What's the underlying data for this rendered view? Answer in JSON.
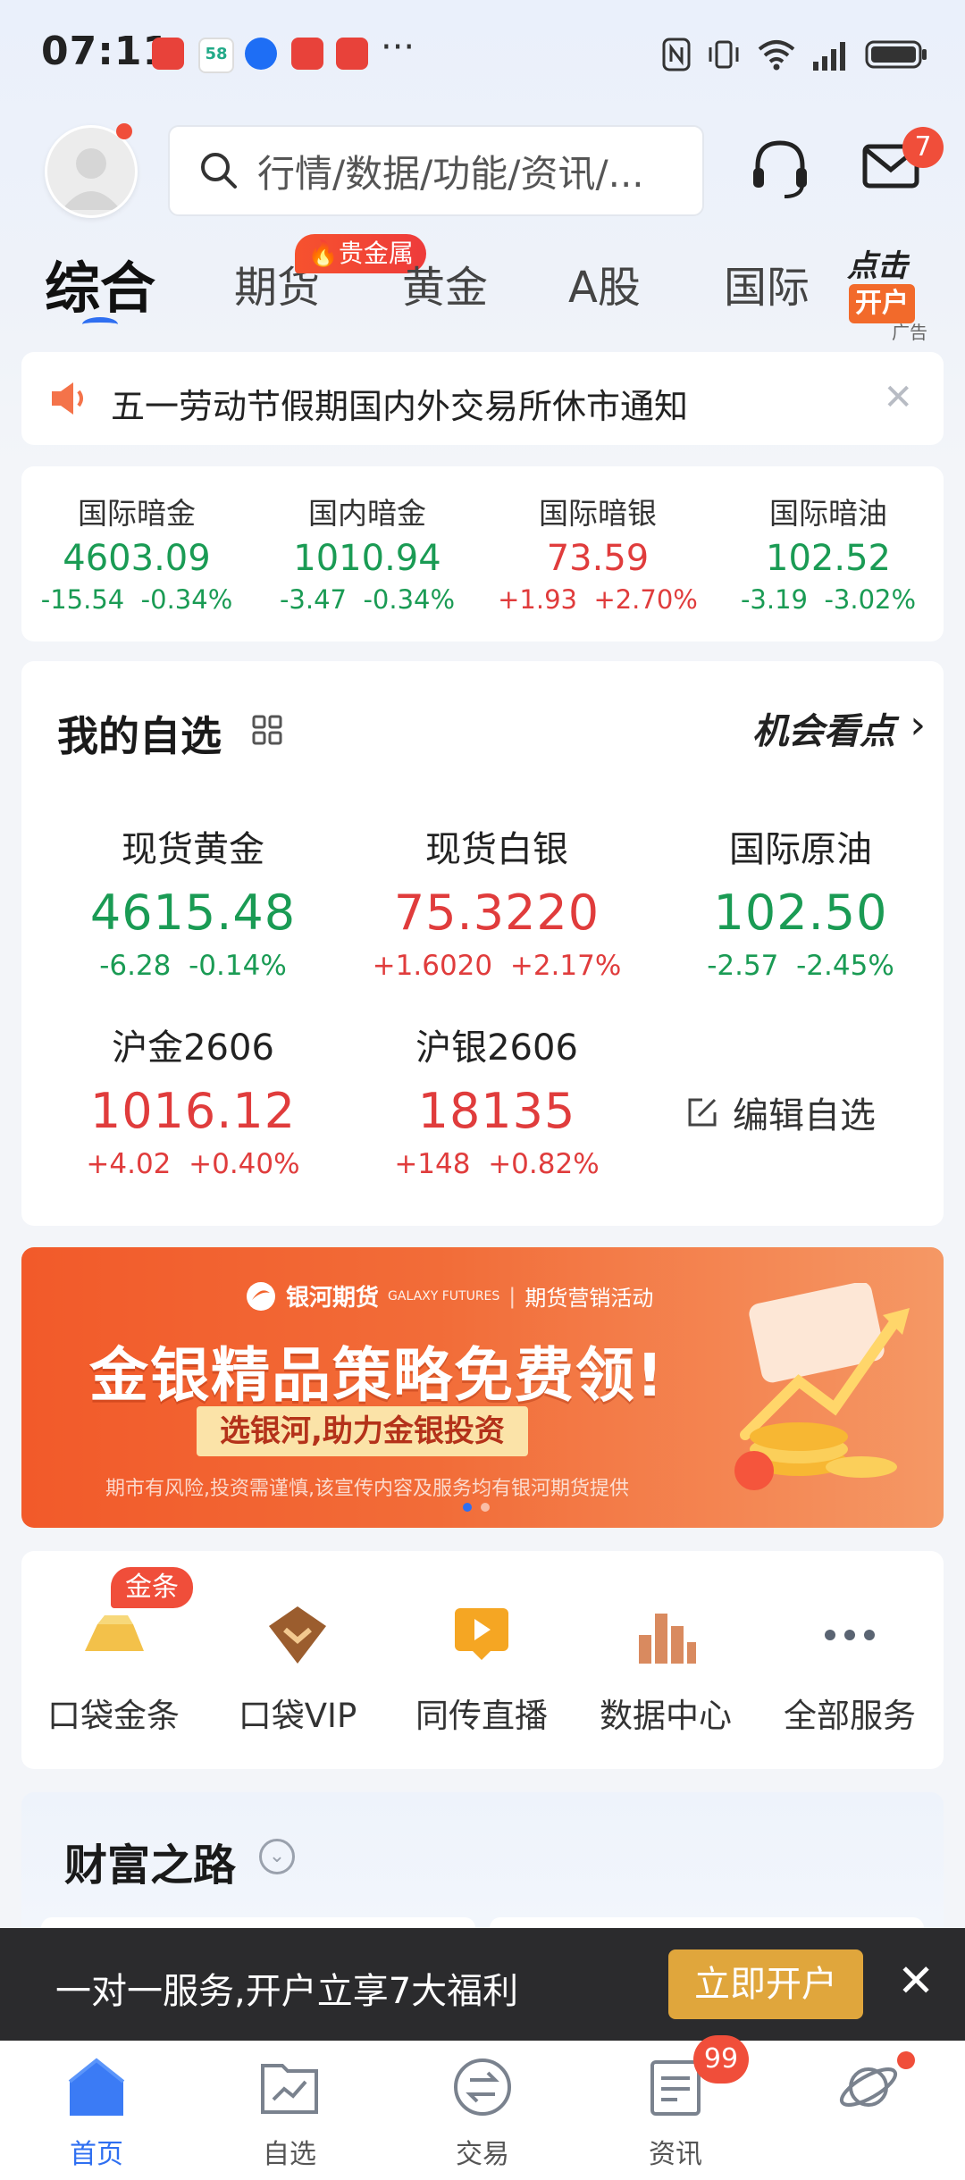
{
  "status_bar": {
    "time": "07:11",
    "more": "···"
  },
  "header": {
    "search_placeholder": "行情/数据/功能/资讯/...",
    "message_badge": "7"
  },
  "tabs": [
    {
      "label": "综合",
      "active": true
    },
    {
      "label": "期货",
      "active": false,
      "badge": "贵金属"
    },
    {
      "label": "黄金",
      "active": false
    },
    {
      "label": "A股",
      "active": false
    },
    {
      "label": "国际",
      "active": false
    }
  ],
  "ad": {
    "line1": "点击",
    "line2": "开户",
    "tag": "广告"
  },
  "notice": {
    "text": "五一劳动节假期国内外交易所休市通知"
  },
  "indices": [
    {
      "name": "国际暗金",
      "value": "4603.09",
      "change": "-15.54",
      "pct": "-0.34%",
      "dir": "down"
    },
    {
      "name": "国内暗金",
      "value": "1010.94",
      "change": "-3.47",
      "pct": "-0.34%",
      "dir": "down"
    },
    {
      "name": "国际暗银",
      "value": "73.59",
      "change": "+1.93",
      "pct": "+2.70%",
      "dir": "up"
    },
    {
      "name": "国际暗油",
      "value": "102.52",
      "change": "-3.19",
      "pct": "-3.02%",
      "dir": "down"
    }
  ],
  "watchlist": {
    "title": "我的自选",
    "opportunity": "机会看点",
    "edit_label": "编辑自选",
    "items": [
      {
        "name": "现货黄金",
        "value": "4615.48",
        "change": "-6.28",
        "pct": "-0.14%",
        "dir": "down"
      },
      {
        "name": "现货白银",
        "value": "75.3220",
        "change": "+1.6020",
        "pct": "+2.17%",
        "dir": "up"
      },
      {
        "name": "国际原油",
        "value": "102.50",
        "change": "-2.57",
        "pct": "-2.45%",
        "dir": "down"
      },
      {
        "name": "沪金2606",
        "value": "1016.12",
        "change": "+4.02",
        "pct": "+0.40%",
        "dir": "up"
      },
      {
        "name": "沪银2606",
        "value": "18135",
        "change": "+148",
        "pct": "+0.82%",
        "dir": "up"
      }
    ]
  },
  "banner": {
    "logo": "银河期货",
    "logo_sub": "GALAXY FUTURES",
    "activity": "期货营销活动",
    "title": "金银精品策略免费领!",
    "subtitle": "选银河,助力金银投资",
    "risk": "期市有风险,投资需谨慎,该宣传内容及服务均有银河期货提供"
  },
  "services": [
    {
      "label": "口袋金条",
      "badge": "金条",
      "icon": "gold-bar-icon"
    },
    {
      "label": "口袋VIP",
      "icon": "vip-diamond-icon"
    },
    {
      "label": "同传直播",
      "icon": "live-play-icon"
    },
    {
      "label": "数据中心",
      "icon": "bar-chart-icon"
    },
    {
      "label": "全部服务",
      "icon": "more-dots-icon"
    }
  ],
  "wealth": {
    "title": "财富之路"
  },
  "promo": {
    "text": "一对一服务,开户立享7大福利",
    "button": "立即开户"
  },
  "nav": [
    {
      "label": "首页",
      "active": true
    },
    {
      "label": "自选",
      "active": false
    },
    {
      "label": "交易",
      "active": false
    },
    {
      "label": "资讯",
      "active": false,
      "badge": "99"
    },
    {
      "label": "",
      "active": false
    }
  ],
  "colors": {
    "up": "#e03c3c",
    "down": "#1a9b54",
    "accent": "#2f6ff1",
    "promo_btn": "#e0a63c"
  }
}
